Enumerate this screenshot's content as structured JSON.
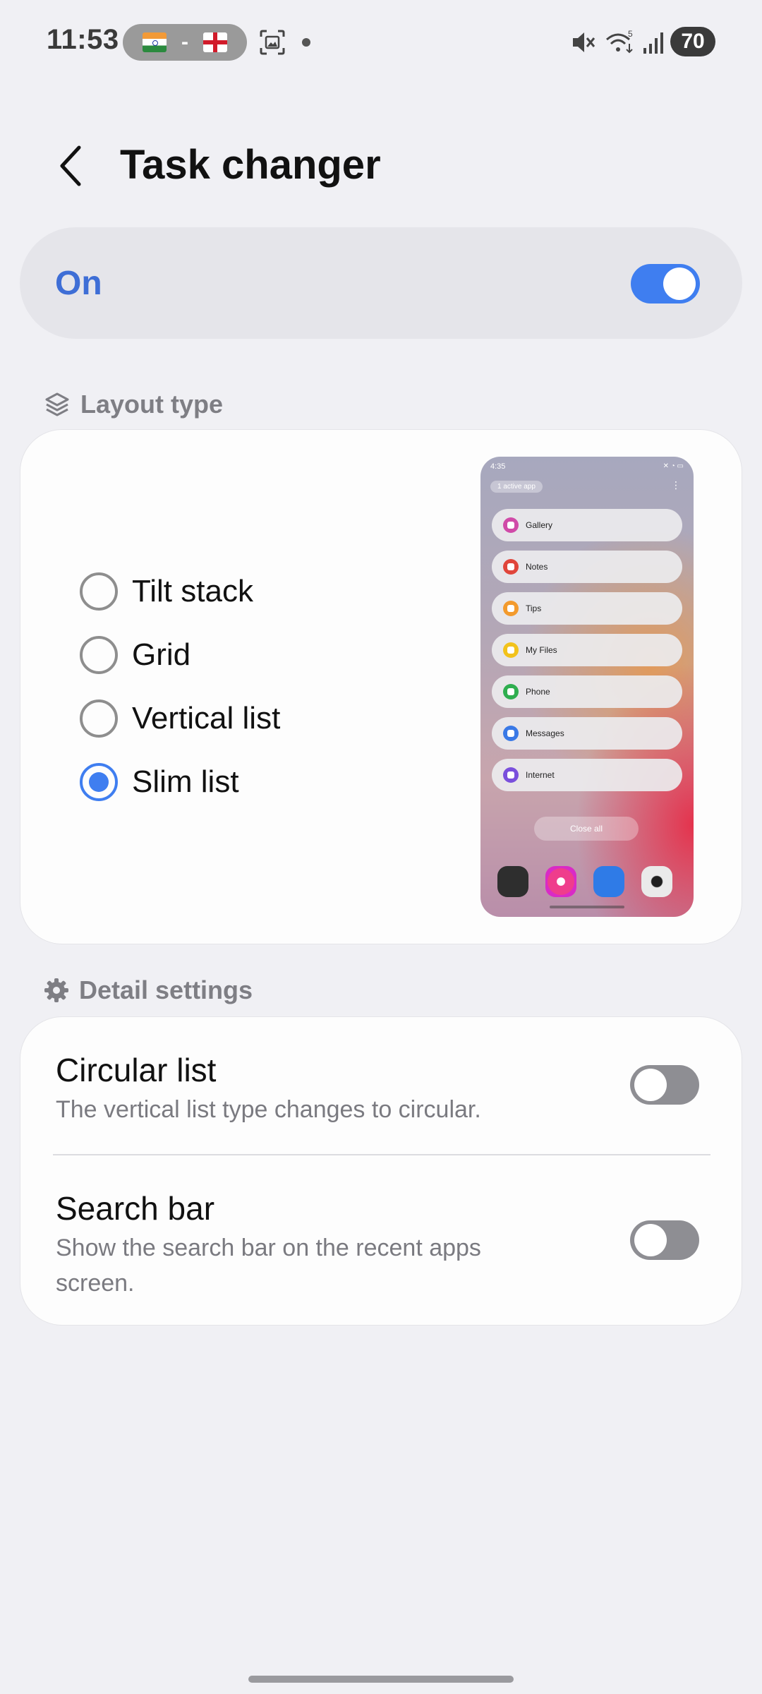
{
  "status": {
    "time": "11:53",
    "score_separator": "-",
    "battery": "70",
    "icons": [
      "india-flag-icon",
      "england-flag-icon",
      "screenshot-icon",
      "notification-dot-icon",
      "mute-icon",
      "wifi-icon",
      "signal-icon"
    ]
  },
  "header": {
    "title": "Task changer",
    "back_icon": "chevron-left-icon"
  },
  "master_switch": {
    "label": "On",
    "state": "on",
    "accent": "#3f7ef0",
    "label_color": "#3e6ed6"
  },
  "layout_section": {
    "header": "Layout type",
    "icon": "layers-icon",
    "options": [
      {
        "label": "Tilt stack",
        "selected": false
      },
      {
        "label": "Grid",
        "selected": false
      },
      {
        "label": "Vertical list",
        "selected": false
      },
      {
        "label": "Slim list",
        "selected": true
      }
    ],
    "preview": {
      "time": "4:35",
      "chip": "1 active app",
      "apps": [
        {
          "name": "Gallery",
          "color": "#d04aa8"
        },
        {
          "name": "Notes",
          "color": "#e0453b"
        },
        {
          "name": "Tips",
          "color": "#f39a2d"
        },
        {
          "name": "My Files",
          "color": "#f2c21b"
        },
        {
          "name": "Phone",
          "color": "#2fae4f"
        },
        {
          "name": "Messages",
          "color": "#3a79e6"
        },
        {
          "name": "Internet",
          "color": "#7a4fdc"
        }
      ],
      "close_all": "Close all",
      "dock": [
        "calculator-icon",
        "gallery-icon",
        "messages-icon",
        "camera-icon"
      ]
    }
  },
  "detail_section": {
    "header": "Detail settings",
    "icon": "gear-icon",
    "items": [
      {
        "title": "Circular list",
        "subtitle": "The vertical list type changes to circular.",
        "state": "off"
      },
      {
        "title": "Search bar",
        "subtitle": "Show the search bar on the recent apps screen.",
        "state": "off"
      }
    ]
  }
}
